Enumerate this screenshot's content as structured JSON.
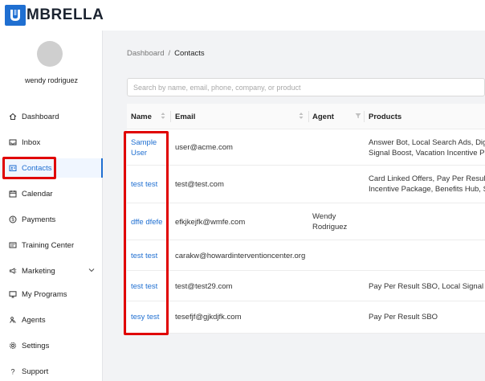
{
  "brand": {
    "name": "MBRELLA",
    "accent": "#1f6fd1"
  },
  "user": {
    "name": "wendy rodriguez"
  },
  "sidebar": {
    "items": [
      {
        "label": "Dashboard",
        "icon": "home-icon"
      },
      {
        "label": "Inbox",
        "icon": "inbox-icon"
      },
      {
        "label": "Contacts",
        "icon": "contacts-icon",
        "active": true
      },
      {
        "label": "Calendar",
        "icon": "calendar-icon"
      },
      {
        "label": "Payments",
        "icon": "dollar-icon"
      },
      {
        "label": "Training Center",
        "icon": "training-icon"
      },
      {
        "label": "Marketing",
        "icon": "megaphone-icon"
      },
      {
        "label": "My Programs",
        "icon": "monitor-icon"
      },
      {
        "label": "Agents",
        "icon": "agents-icon"
      },
      {
        "label": "Settings",
        "icon": "gear-icon"
      },
      {
        "label": "Support",
        "icon": "question-icon"
      }
    ]
  },
  "breadcrumb": {
    "root": "Dashboard",
    "separator": "/",
    "current": "Contacts"
  },
  "search": {
    "placeholder": "Search by name, email, phone, company, or product",
    "value": ""
  },
  "table": {
    "columns": [
      "Name",
      "Email",
      "Agent",
      "Products"
    ],
    "rows": [
      {
        "name": "Sample User",
        "name_lines": [
          "Sample",
          "User"
        ],
        "email": "user@acme.com",
        "agent": "",
        "agent_lines": [],
        "products_lines": [
          "Answer Bot, Local Search Ads, Digit",
          "Signal Boost, Vacation Incentive Pac"
        ]
      },
      {
        "name": "test test",
        "name_lines": [
          "test test"
        ],
        "email": "test@test.com",
        "agent": "",
        "agent_lines": [],
        "products_lines": [
          "Card Linked Offers, Pay Per Result S",
          "Incentive Package, Benefits Hub, Sa"
        ]
      },
      {
        "name": "dffe dfefe",
        "name_lines": [
          "dffe dfefe"
        ],
        "email": "efkjkejfk@wmfe.com",
        "agent": "Wendy Rodriguez",
        "agent_lines": [
          "Wendy",
          "Rodriguez"
        ],
        "products_lines": []
      },
      {
        "name": "test test",
        "name_lines": [
          "test test"
        ],
        "email": "carakw@howardinterventioncenter.org",
        "agent": "",
        "agent_lines": [],
        "products_lines": []
      },
      {
        "name": "test test",
        "name_lines": [
          "test test"
        ],
        "email": "test@test29.com",
        "agent": "",
        "agent_lines": [],
        "products_lines": [
          "Pay Per Result SBO, Local Signal Boo"
        ]
      },
      {
        "name": "tesy test",
        "name_lines": [
          "tesy test"
        ],
        "email": "tesefjf@gjkdjfk.com",
        "agent": "",
        "agent_lines": [],
        "products_lines": [
          "Pay Per Result SBO"
        ]
      }
    ]
  }
}
